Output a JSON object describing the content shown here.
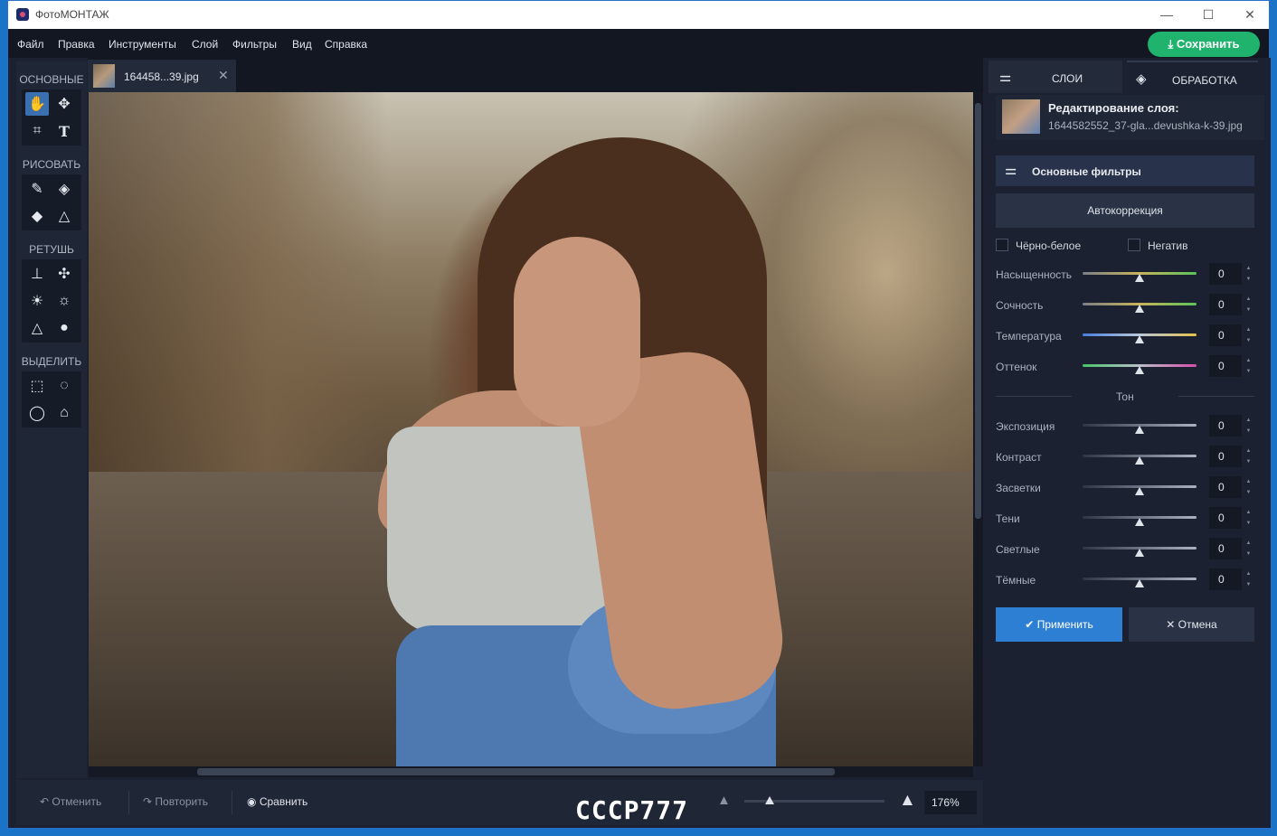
{
  "window": {
    "title": "ФотоМОНТАЖ",
    "minimize": "—",
    "maximize": "☐",
    "close": "✕"
  },
  "menu": [
    "Файл",
    "Правка",
    "Инструменты",
    "Слой",
    "Фильтры",
    "Вид",
    "Справка"
  ],
  "save_label": "Сохранить",
  "toolbox": {
    "sections": [
      "ОСНОВНЫЕ",
      "РИСОВАТЬ",
      "РЕТУШЬ",
      "ВЫДЕЛИТЬ"
    ]
  },
  "document": {
    "tab_name": "164458...39.jpg",
    "close": "✕"
  },
  "bottom": {
    "undo": "Отменить",
    "redo": "Повторить",
    "compare": "Сравнить",
    "zoom_value": "176%",
    "zoom_fraction": 0.18
  },
  "watermark": "СССР777",
  "panel": {
    "tab_layers": "СЛОИ",
    "tab_processing": "ОБРАБОТКА",
    "layer_title": "Редактирование слоя:",
    "layer_file": "1644582552_37-gla...devushka-k-39.jpg",
    "filters_head": "Основные фильтры",
    "auto_btn": "Автокоррекция",
    "bw_label": "Чёрно-белое",
    "negative_label": "Негатив",
    "color_sliders": [
      {
        "label": "Насыщенность",
        "value": "0"
      },
      {
        "label": "Сочность",
        "value": "0"
      },
      {
        "label": "Температура",
        "value": "0"
      },
      {
        "label": "Оттенок",
        "value": "0"
      }
    ],
    "tone_label": "Тон",
    "tone_sliders": [
      {
        "label": "Экспозиция",
        "value": "0"
      },
      {
        "label": "Контраст",
        "value": "0"
      },
      {
        "label": "Засветки",
        "value": "0"
      },
      {
        "label": "Тени",
        "value": "0"
      },
      {
        "label": "Светлые",
        "value": "0"
      },
      {
        "label": "Тёмные",
        "value": "0"
      }
    ],
    "apply": "Применить",
    "cancel": "Отмена"
  },
  "colors": {
    "accent": "#1fb36d",
    "primary": "#2d7fd3",
    "bg": "#1b2130"
  }
}
